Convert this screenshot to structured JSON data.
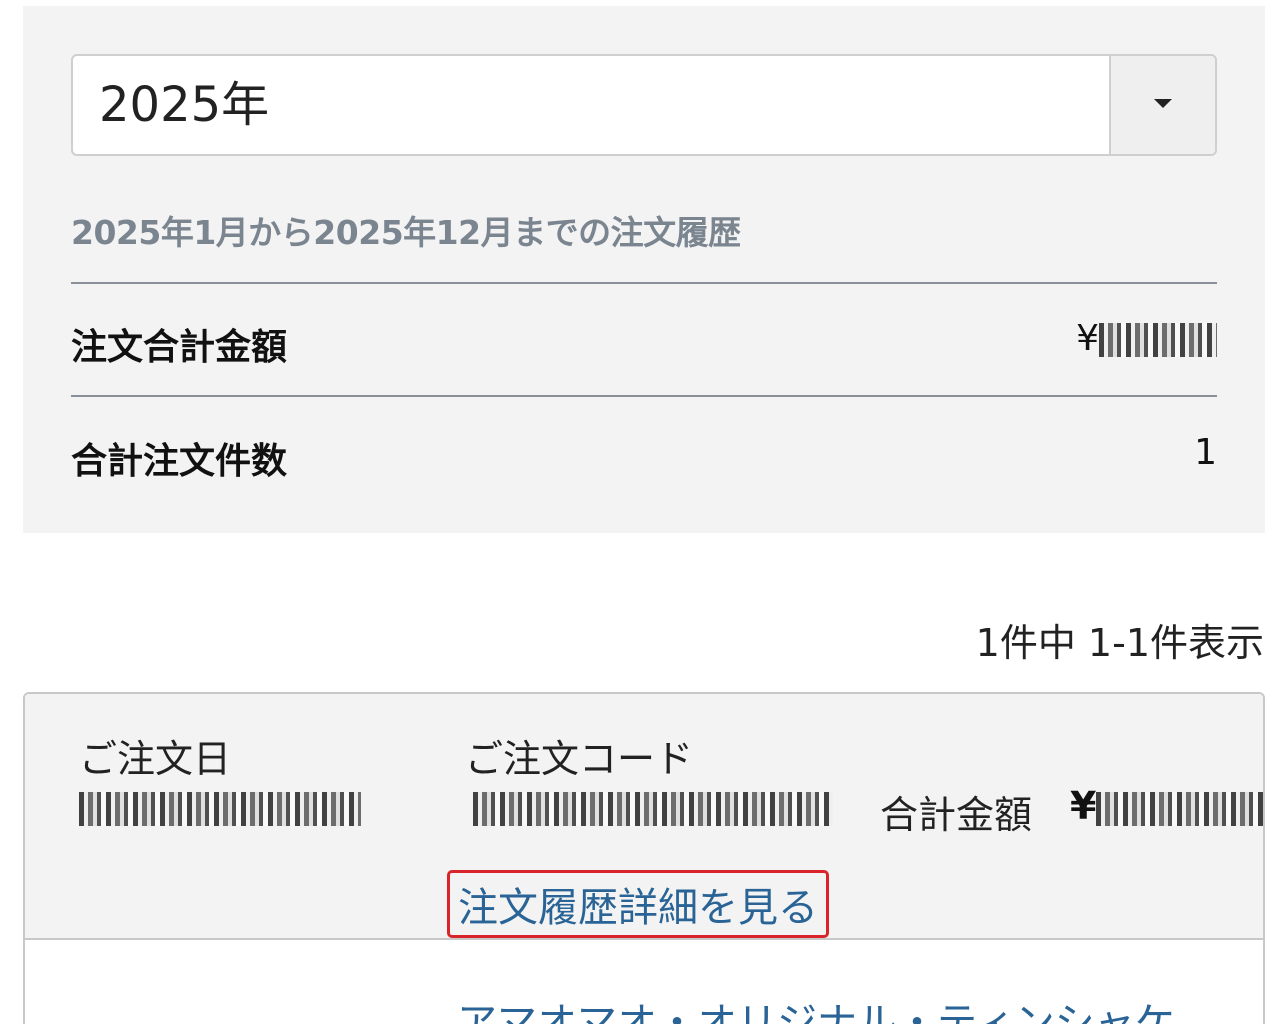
{
  "filter": {
    "year_value": "2025年",
    "period_text": "2025年1月から2025年12月までの注文履歴"
  },
  "summary": {
    "total_amount_label": "注文合計金額",
    "total_amount_value": "¥",
    "order_count_label": "合計注文件数",
    "order_count_value": "1"
  },
  "results": {
    "count_text": "1件中 1-1件表示"
  },
  "order": {
    "date_label": "ご注文日",
    "code_label": "ご注文コード",
    "total_label": "合計金額",
    "total_value": "¥",
    "detail_link": "注文履歴詳細を見る",
    "product_name": "アマオマオ・オリジナル・ティンシャケ"
  },
  "colors": {
    "panel_bg": "#f3f3f3",
    "link": "#2a6496",
    "highlight_border": "#d9242b",
    "period_text": "#7a8590"
  }
}
